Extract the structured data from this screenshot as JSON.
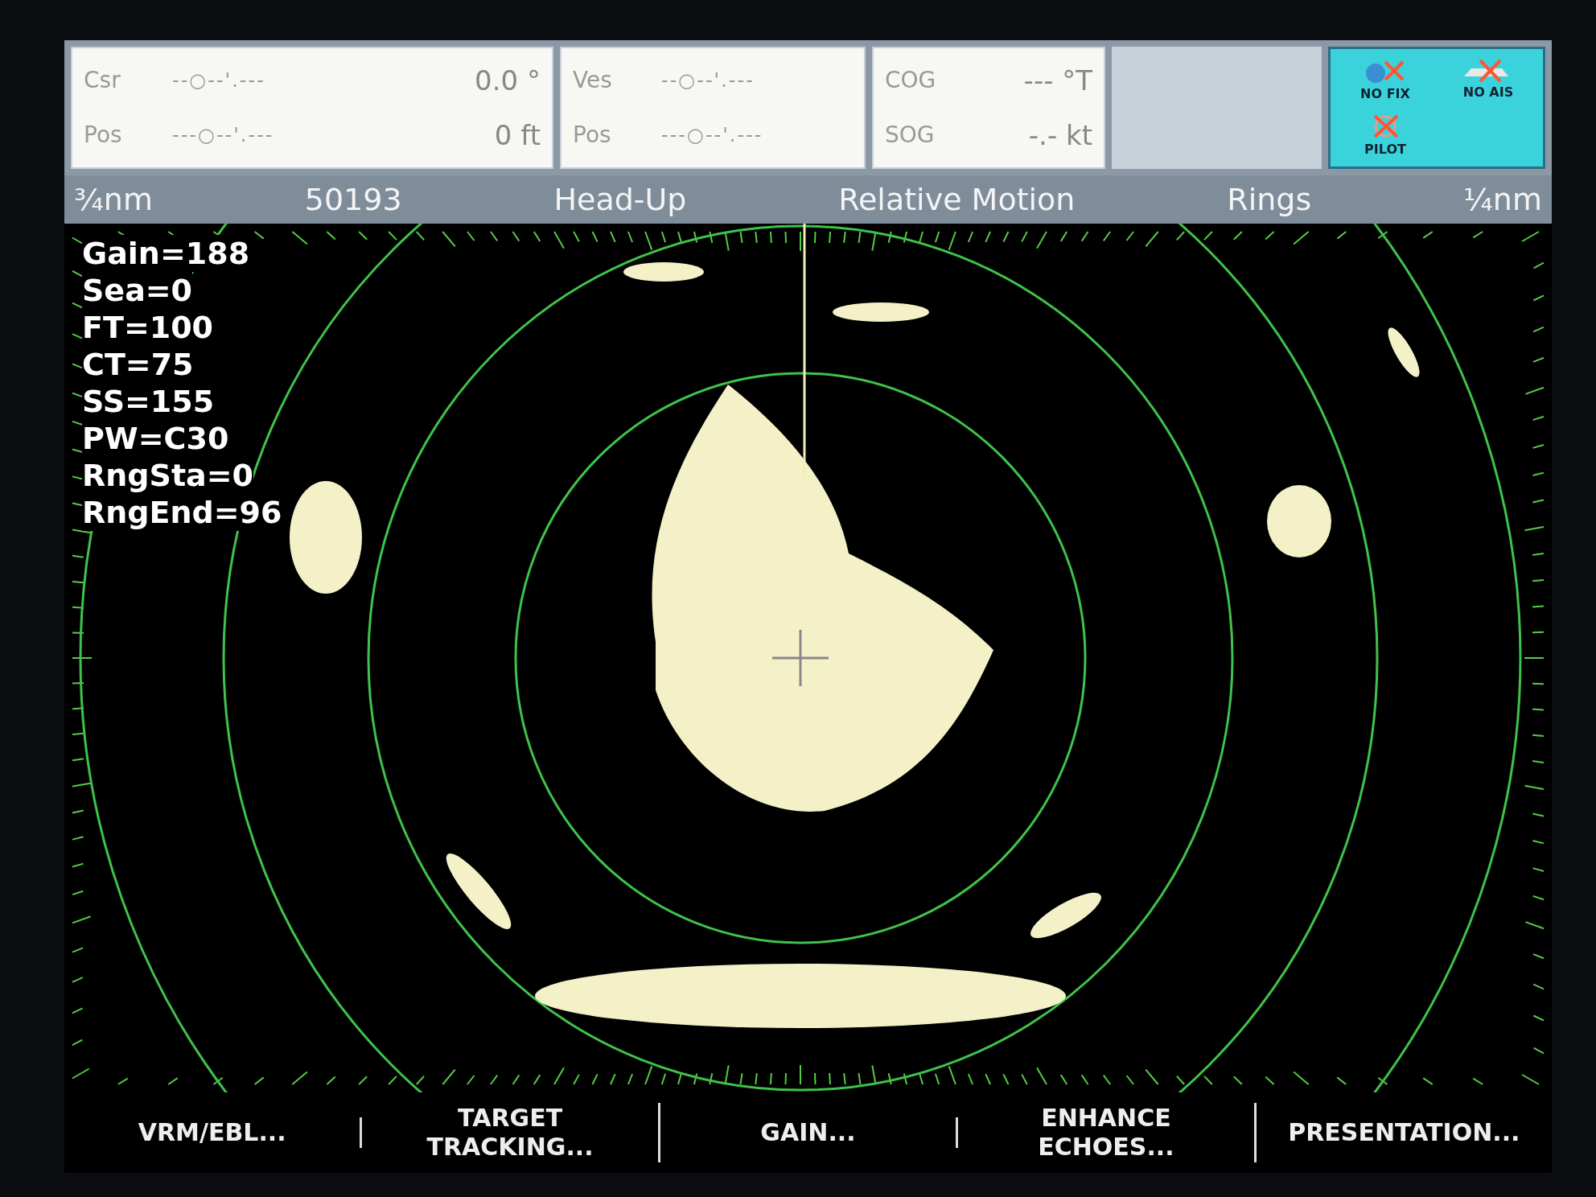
{
  "readouts": [
    {
      "rows": [
        {
          "label": "Csr",
          "position": "--○--'.---",
          "value": "0.0 °"
        },
        {
          "label": "Pos",
          "position": "---○--'.---",
          "value": "0 ft"
        }
      ]
    },
    {
      "rows": [
        {
          "label": "Ves",
          "position": "--○--'.---",
          "value": ""
        },
        {
          "label": "Pos",
          "position": "---○--'.---",
          "value": ""
        }
      ]
    },
    {
      "rows": [
        {
          "label": "COG",
          "position": "",
          "value": "--- °T"
        },
        {
          "label": "SOG",
          "position": "",
          "value": "-.- kt"
        }
      ]
    }
  ],
  "status_icons": [
    {
      "kind": "fix",
      "label": "NO FIX"
    },
    {
      "kind": "ais",
      "label": "NO AIS"
    },
    {
      "kind": "pilot",
      "label": "PILOT"
    }
  ],
  "status_bar": [
    "¾nm",
    "50193",
    "Head-Up",
    "Relative Motion",
    "Rings",
    "¼nm"
  ],
  "settings": [
    "Gain=188",
    "Sea=0",
    "FT=100",
    "CT=75",
    "SS=155",
    "PW=C30",
    "RngSta=0",
    "RngEnd=96"
  ],
  "softkeys": [
    "VRM/EBL...",
    "TARGET\nTRACKING...",
    "GAIN...",
    "ENHANCE\nECHOES...",
    "PRESENTATION..."
  ]
}
